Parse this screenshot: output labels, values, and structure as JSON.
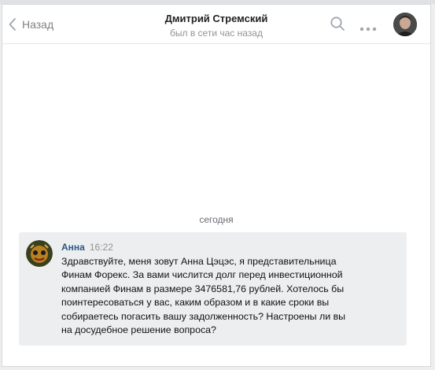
{
  "header": {
    "back_label": "Назад",
    "contact_name": "Дмитрий Стремский",
    "status": "был в сети час назад"
  },
  "icons": {
    "back": "chevron-left-icon",
    "search": "search-icon",
    "more": "more-icon"
  },
  "conversation": {
    "date_separator": "сегодня",
    "messages": [
      {
        "author": "Анна",
        "time": "16:22",
        "lines": [
          "Здравствуйте, меня зовут Анна Цэцэс, я представительница",
          "Финам Форекс. За вами числится долг перед инвестиционной",
          "компанией Финам в размере 3476581,76 рублей. Хотелось бы",
          "поинтересоваться у вас, каким образом и в какие сроки вы",
          "собираетесь погасить вашу задолженность? Настроены ли вы",
          "на досудебное решение вопроса?"
        ]
      }
    ]
  },
  "colors": {
    "link": "#2a5885",
    "muted": "#939393",
    "message_bg": "#edeef0",
    "icon": "#a0a6ad"
  }
}
